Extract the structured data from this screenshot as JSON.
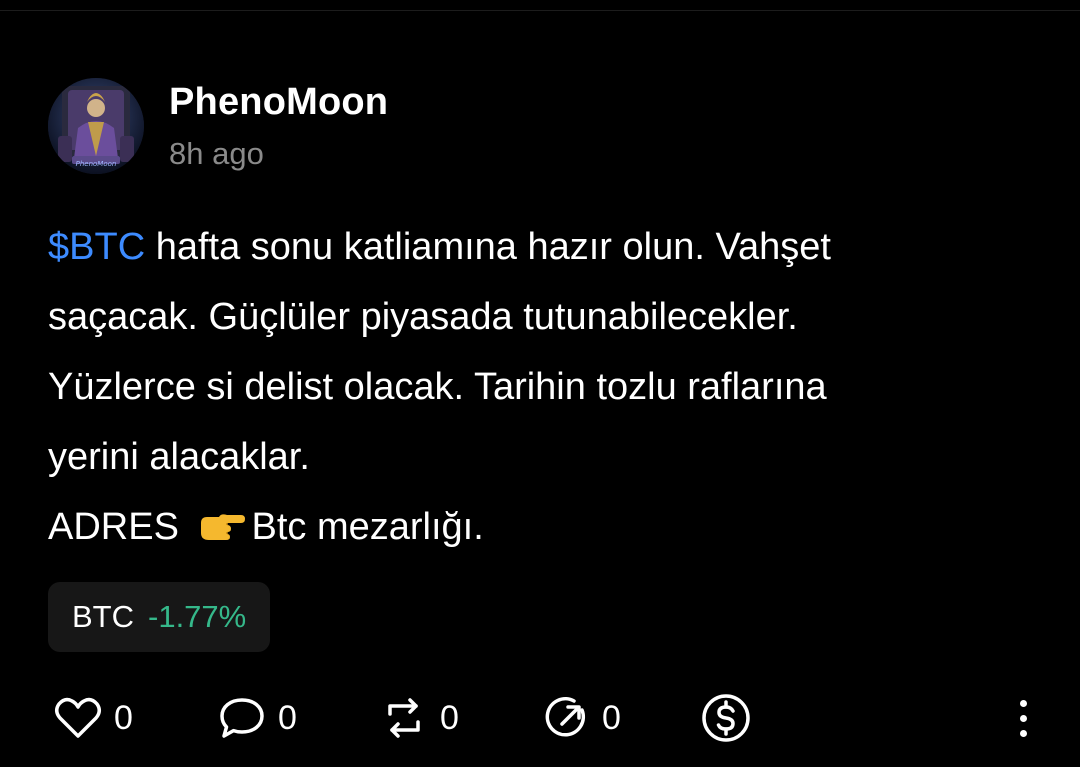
{
  "post": {
    "author_name": "PhenoMoon",
    "time_ago": "8h ago",
    "avatar_icon": "avatar-image",
    "body": {
      "line1_cashtag": "$BTC",
      "line1_rest": " hafta sonu katliamına hazır olun. Vahşet",
      "line2": "saçacak. Güçlüler piyasada tutunabilecekler.",
      "line3": "Yüzlerce si delist olacak. Tarihin tozlu raflarına",
      "line4": "yerini alacaklar.",
      "line5_prefix": "ADRES ",
      "line5_emoji": "👉",
      "line5_suffix": "Btc mezarlığı."
    },
    "ticker": {
      "symbol": "BTC",
      "change": "-1.77%"
    }
  },
  "actions": {
    "like": {
      "icon": "heart-icon",
      "count": "0"
    },
    "comment": {
      "icon": "comment-icon",
      "count": "0"
    },
    "repost": {
      "icon": "repost-icon",
      "count": "0"
    },
    "share": {
      "icon": "share-icon",
      "count": "0"
    },
    "tip": {
      "icon": "dollar-coin-icon"
    },
    "more": {
      "icon": "more-vertical-icon"
    }
  },
  "colors": {
    "background": "#000000",
    "text": "#ffffff",
    "muted": "#8a8a8a",
    "cashtag": "#3d8bff",
    "change_negative_shown": "#35b88a",
    "chip_background": "#171717"
  }
}
